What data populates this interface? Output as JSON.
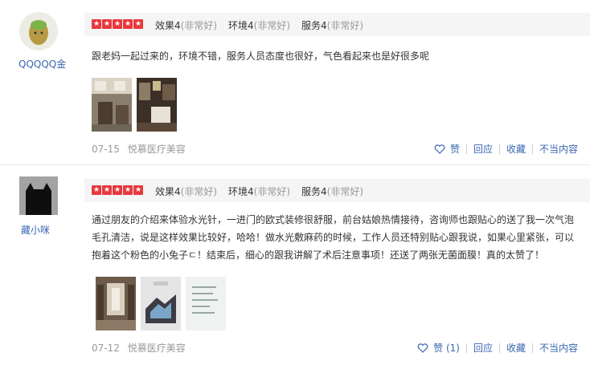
{
  "reviews": [
    {
      "username": "QQQQQ金",
      "stars": [
        "★",
        "★",
        "★",
        "★",
        "★"
      ],
      "scores": [
        {
          "label": "效果4",
          "quality": "(非常好)"
        },
        {
          "label": "环境4",
          "quality": "(非常好)"
        },
        {
          "label": "服务4",
          "quality": "(非常好)"
        }
      ],
      "text": "跟老妈一起过来的，环境不错，服务人员态度也很好，气色看起来也是好很多呢",
      "date": "07-15",
      "shop": "悦慕医疗美容",
      "actions": {
        "like": "赞",
        "reply": "回应",
        "fav": "收藏",
        "report": "不当内容"
      }
    },
    {
      "username": "藏小咪",
      "stars": [
        "★",
        "★",
        "★",
        "★",
        "★"
      ],
      "scores": [
        {
          "label": "效果4",
          "quality": "(非常好)"
        },
        {
          "label": "环境4",
          "quality": "(非常好)"
        },
        {
          "label": "服务4",
          "quality": "(非常好)"
        }
      ],
      "text_lines": [
        "通过朋友的介绍来体验水光针，一进门的欧式装修很舒服，前台姑娘热情接待，咨询师也跟贴心的送了我一次气泡",
        "毛孔清洁，说是这样效果比较好，哈哈！做水光敷麻药的时候，工作人员还特别贴心跟我说，如果心里紧张，可以",
        "抱着这个粉色的小兔子ㄷ！结束后，细心的跟我讲解了术后注意事项！还送了两张无菌面膜！真的太赞了！"
      ],
      "date": "07-12",
      "shop": "悦慕医疗美容",
      "actions": {
        "like": "赞 (1)",
        "reply": "回应",
        "fav": "收藏",
        "report": "不当内容"
      }
    }
  ],
  "colors": {
    "star": "#e6393f",
    "link": "#3a67b0",
    "muted": "#999999"
  }
}
